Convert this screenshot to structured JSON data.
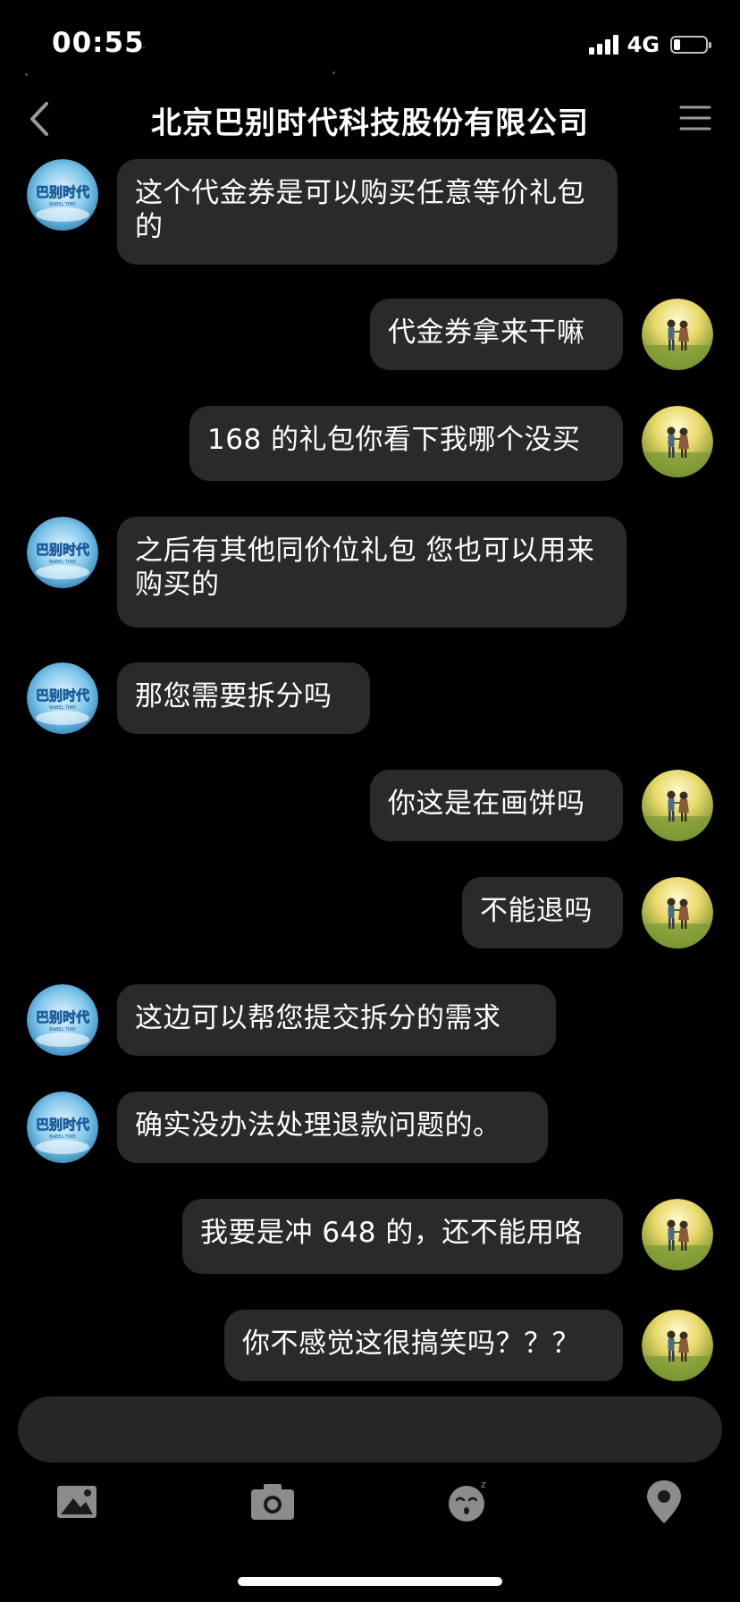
{
  "status_bar": {
    "time": "00:55",
    "network": "4G",
    "battery_level": 0.22,
    "signal_bars": 4
  },
  "header": {
    "title": "北京巴别时代科技股份有限公司",
    "back_icon": "chevron-left-icon",
    "menu_icon": "menu-icon"
  },
  "avatars": {
    "company_logo_text": "巴别时代",
    "company_logo_subtext": "BABEL TIME",
    "user_photo": "two children walking in a field"
  },
  "messages": [
    {
      "side": "left",
      "text": "这个代金券是可以购买任意等价礼包的"
    },
    {
      "side": "right",
      "text": "代金券拿来干嘛"
    },
    {
      "side": "right",
      "text": "168 的礼包你看下我哪个没买"
    },
    {
      "side": "left",
      "text": "之后有其他同价位礼包 您也可以用来购买的"
    },
    {
      "side": "left",
      "text": "那您需要拆分吗"
    },
    {
      "side": "right",
      "text": "你这是在画饼吗"
    },
    {
      "side": "right",
      "text": "不能退吗"
    },
    {
      "side": "left",
      "text": "这边可以帮您提交拆分的需求"
    },
    {
      "side": "left",
      "text": "确实没办法处理退款问题的。"
    },
    {
      "side": "right",
      "text": "我要是冲 648 的，还不能用咯"
    },
    {
      "side": "right",
      "text": "你不感觉这很搞笑吗？？？"
    }
  ],
  "composer": {
    "placeholder": ""
  },
  "toolbar": {
    "items": [
      "image-icon",
      "camera-icon",
      "emoji-icon",
      "location-icon"
    ]
  },
  "colors": {
    "background": "#000000",
    "bubble": "#2a2a2a",
    "text": "#ffffff",
    "icon": "#8c8c8c"
  }
}
